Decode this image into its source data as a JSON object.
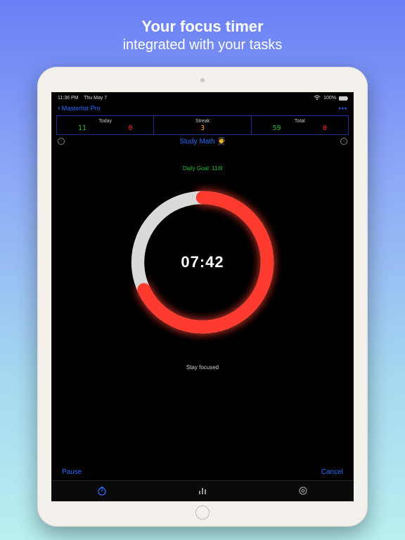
{
  "promo": {
    "title": "Your focus timer",
    "subtitle": "integrated with your tasks"
  },
  "statusbar": {
    "time": "11:36 PM",
    "date": "Thu May 7",
    "wifi": "wifi",
    "battery_pct": "100%"
  },
  "navbar": {
    "back_label": "Masterlist Pro",
    "more_label": "•••"
  },
  "stats": {
    "today": {
      "label": "Today",
      "done": "11",
      "missed": "0"
    },
    "streak": {
      "label": "Streak",
      "value": "3"
    },
    "total": {
      "label": "Total",
      "done": "59",
      "missed": "0"
    }
  },
  "task": {
    "title": "Study Math 🧑‍🎓",
    "prev_icon": "‹",
    "next_icon": "›"
  },
  "timer": {
    "goal_label": "Daily Goal: 11/8",
    "time": "07:42",
    "progress_deg": 245,
    "subtext": "Stay focused",
    "ring_active_color": "#ff3b30",
    "ring_bg_color": "#d9d9d9"
  },
  "actions": {
    "pause": "Pause",
    "cancel": "Cancel"
  },
  "tabs": {
    "timer_icon": "timer-icon",
    "stats_icon": "bars-icon",
    "settings_icon": "gear-icon"
  }
}
